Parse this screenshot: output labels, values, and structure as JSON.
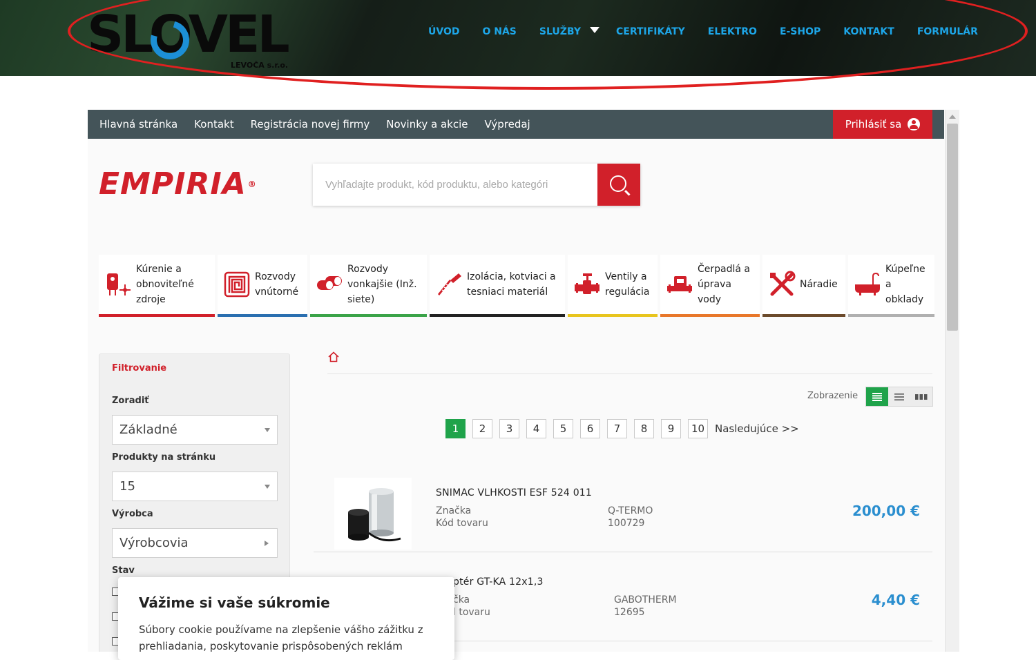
{
  "site": {
    "logo_text": "SLOVEL",
    "logo_subtext": "LEVOČA s.r.o.",
    "nav": [
      "ÚVOD",
      "O NÁS",
      "SLUŽBY",
      "CERTIFIKÁTY",
      "ELEKTRO",
      "E-SHOP",
      "KONTAKT",
      "FORMULÁR"
    ]
  },
  "shop": {
    "topnav": [
      "Hlavná stránka",
      "Kontakt",
      "Registrácia novej firmy",
      "Novinky a akcie",
      "Výpredaj"
    ],
    "login_label": "Prihlásiť sa",
    "brand": "EMPIRIA",
    "brand_mark": "®",
    "search_placeholder": "Vyhľadajte produkt, kód produktu, alebo kategóri",
    "categories": [
      {
        "label": "Kúrenie a obnoviteľné zdroje",
        "color": "#d1202a",
        "icon": "heater-icon"
      },
      {
        "label": "Rozvody vnútorné",
        "color": "#2a6fb0",
        "icon": "floor-heating-icon"
      },
      {
        "label": "Rozvody vonkajšie (Inž. siete)",
        "color": "#3aa348",
        "icon": "pipes-icon"
      },
      {
        "label": "Izolácia, kotviaci a tesniaci materiál",
        "color": "#222222",
        "icon": "screw-icon"
      },
      {
        "label": "Ventily a regulácia",
        "color": "#e8c51d",
        "icon": "valve-icon"
      },
      {
        "label": "Čerpadlá a úprava vody",
        "color": "#e8772a",
        "icon": "pump-icon"
      },
      {
        "label": "Náradie",
        "color": "#6b4a2b",
        "icon": "tools-icon"
      },
      {
        "label": "Kúpeľne a obklady",
        "color": "#b0b0b0",
        "icon": "bathtub-icon"
      }
    ],
    "filter": {
      "title": "Filtrovanie",
      "sort_label": "Zoradiť",
      "sort_value": "Základné",
      "per_page_label": "Produkty na stránku",
      "per_page_value": "15",
      "maker_label": "Výrobca",
      "maker_value": "Výrobcovia",
      "state_label": "Stav"
    },
    "view_label": "Zobrazenie",
    "pages": [
      "1",
      "2",
      "3",
      "4",
      "5",
      "6",
      "7",
      "8",
      "9",
      "10"
    ],
    "next_label": "Nasledujúce >>",
    "products": [
      {
        "name": "SNIMAC VLHKOSTI ESF 524 011",
        "brand_key": "Značka",
        "brand": "Q-TERMO",
        "code_key": "Kód tovaru",
        "code": "100729",
        "price": "200,00 €"
      },
      {
        "name": "ptér GT-KA 12x1,3",
        "brand_key": "čka",
        "brand": "GABOTHERM",
        "code_key": "l tovaru",
        "code": "12695",
        "price": "4,40 €"
      }
    ]
  },
  "cookie": {
    "title": "Vážime si vaše súkromie",
    "text": "Súbory cookie používame na zlepšenie vášho zážitku z prehliadania, poskytovanie prispôsobených reklám"
  },
  "colors": {
    "accent_red": "#d1202a",
    "nav_blue": "#1da6e8",
    "active_green": "#1fa34a",
    "price_blue": "#2a8ecf",
    "shopnav_bg": "#445459"
  }
}
